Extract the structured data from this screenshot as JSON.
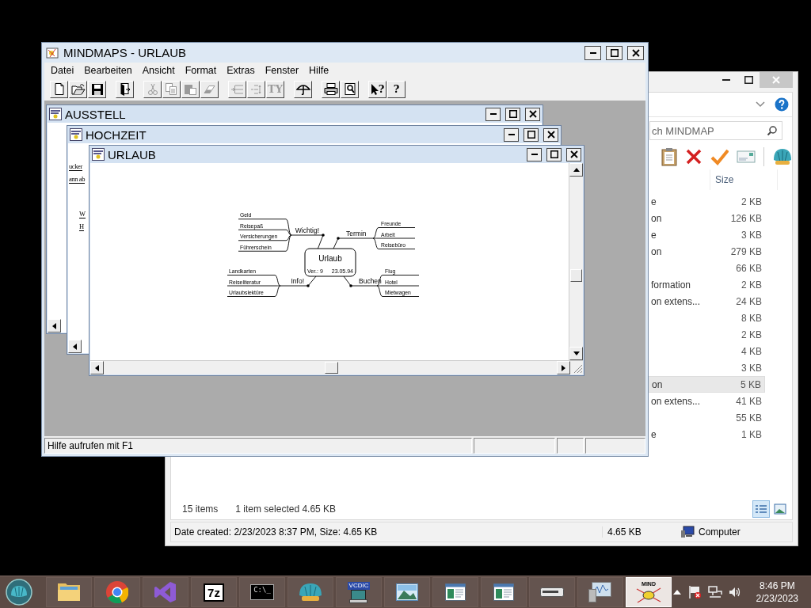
{
  "explorer": {
    "search": {
      "placeholder": "ch MINDMAP"
    },
    "column": "Size",
    "rows": [
      {
        "type": "e",
        "size": "2 KB",
        "selected": false
      },
      {
        "type": "on",
        "size": "126 KB",
        "selected": false
      },
      {
        "type": "e",
        "size": "3 KB",
        "selected": false
      },
      {
        "type": "on",
        "size": "279 KB",
        "selected": false
      },
      {
        "type": "",
        "size": "66 KB",
        "selected": false
      },
      {
        "type": "formation",
        "size": "2 KB",
        "selected": false
      },
      {
        "type": "on extens...",
        "size": "24 KB",
        "selected": false
      },
      {
        "type": "",
        "size": "8 KB",
        "selected": false
      },
      {
        "type": "",
        "size": "2 KB",
        "selected": false
      },
      {
        "type": "",
        "size": "4 KB",
        "selected": false
      },
      {
        "type": "",
        "size": "3 KB",
        "selected": false
      },
      {
        "type": "on",
        "size": "5 KB",
        "selected": true
      },
      {
        "type": "on extens...",
        "size": "41 KB",
        "selected": false
      },
      {
        "type": "",
        "size": "55 KB",
        "selected": false
      },
      {
        "type": "e",
        "size": "1 KB",
        "selected": false
      }
    ],
    "item_count": "15 items",
    "selection_info": "1 item selected  4.65 KB",
    "view_buttons": [
      {
        "kind": "details",
        "selected": true
      },
      {
        "kind": "preview",
        "selected": false
      }
    ],
    "status": {
      "details": "Date created: 2/23/2023 8:37 PM, Size: 4.65 KB",
      "size": "4.65 KB",
      "location": "Computer"
    }
  },
  "mindmaps": {
    "title": "MINDMAPS - URLAUB",
    "menu": [
      "Datei",
      "Bearbeiten",
      "Ansicht",
      "Format",
      "Extras",
      "Fenster",
      "Hilfe"
    ],
    "toolbar": [
      [
        {
          "kind": "new",
          "disabled": false
        },
        {
          "kind": "open",
          "disabled": false
        },
        {
          "kind": "save",
          "disabled": false
        }
      ],
      [
        {
          "kind": "exit",
          "disabled": false
        }
      ],
      [
        {
          "kind": "cut",
          "disabled": true
        },
        {
          "kind": "copy",
          "disabled": true
        },
        {
          "kind": "paste",
          "disabled": true
        },
        {
          "kind": "erase",
          "disabled": true
        }
      ],
      [
        {
          "kind": "insert-left",
          "disabled": true
        },
        {
          "kind": "insert-both",
          "disabled": true
        },
        {
          "kind": "text",
          "label": "TY",
          "disabled": true
        }
      ],
      [
        {
          "kind": "umbrella",
          "disabled": false
        }
      ],
      [
        {
          "kind": "print",
          "disabled": false
        },
        {
          "kind": "preview",
          "disabled": false
        }
      ],
      [
        {
          "kind": "context-help",
          "label": "?",
          "disabled": false
        },
        {
          "kind": "help",
          "label": "?",
          "disabled": false
        }
      ]
    ],
    "documents": [
      {
        "title": "AUSSTELL"
      },
      {
        "title": "HOCHZEIT",
        "lines": [
          "ucker",
          "ann ab",
          "W",
          "H"
        ]
      },
      {
        "title": "URLAUB",
        "mindmap": {
          "title": "Urlaub",
          "version": "Ver.: 9",
          "date": "23.05.94",
          "branches": [
            {
              "label": "Wichtig!",
              "children": [
                "Geld",
                "Reisepaß",
                "Versicherungen",
                "Führerschein"
              ]
            },
            {
              "label": "Termin",
              "children": [
                "Freunde",
                "Arbeit",
                "Reisebüro"
              ]
            },
            {
              "label": "Info!",
              "children": [
                "Landkarten",
                "Reiseliteratur",
                "Urlaubslektüre"
              ]
            },
            {
              "label": "Buchen",
              "children": [
                "Flug",
                "Hotel",
                "Mietwagen"
              ]
            }
          ]
        }
      }
    ],
    "status": "Hilfe aufrufen mit F1"
  },
  "taskbar": {
    "items": [
      {
        "kind": "folder",
        "active": false
      },
      {
        "kind": "chrome",
        "active": false
      },
      {
        "kind": "vs",
        "active": false
      },
      {
        "kind": "sevenzip",
        "label": "7z",
        "active": false
      },
      {
        "kind": "console",
        "label": "C:\\_",
        "active": false
      },
      {
        "kind": "shell",
        "active": false
      },
      {
        "kind": "vcdic",
        "label": "VCDIC",
        "active": false
      },
      {
        "kind": "photo",
        "active": false
      },
      {
        "kind": "document",
        "active": false
      },
      {
        "kind": "document",
        "active": false
      },
      {
        "kind": "drive",
        "active": false
      },
      {
        "kind": "monitor",
        "active": false
      },
      {
        "kind": "mind",
        "label": "MIND",
        "active": true
      }
    ],
    "clock": {
      "time": "8:46 PM",
      "date": "2/23/2023"
    }
  }
}
